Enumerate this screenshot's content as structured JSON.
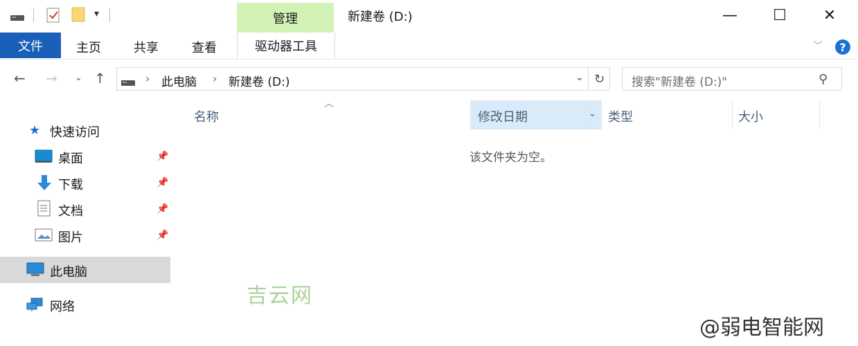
{
  "titlebar": {
    "context_tab": "管理",
    "window_title": "新建卷 (D:)",
    "minimize": "—",
    "maximize": "☐",
    "close": "✕"
  },
  "ribbon": {
    "tabs": [
      "文件",
      "主页",
      "共享",
      "查看"
    ],
    "drive_tools": "驱动器工具",
    "help": "?"
  },
  "address": {
    "segments": [
      "此电脑",
      "新建卷 (D:)"
    ],
    "search_placeholder": "搜索\"新建卷 (D:)\""
  },
  "nav": {
    "quick_access": "快速访问",
    "items": [
      "桌面",
      "下载",
      "文档",
      "图片"
    ],
    "this_pc": "此电脑",
    "network": "网络"
  },
  "columns": [
    "名称",
    "修改日期",
    "类型",
    "大小"
  ],
  "empty_message": "该文件夹为空。",
  "watermarks": [
    "吉云网",
    "@弱电智能网"
  ],
  "colors": {
    "accent": "#1a5fb8",
    "context_tab": "#d3f2b6",
    "selected": "#d9d9d9",
    "sorted_column": "#d9ebf9"
  }
}
